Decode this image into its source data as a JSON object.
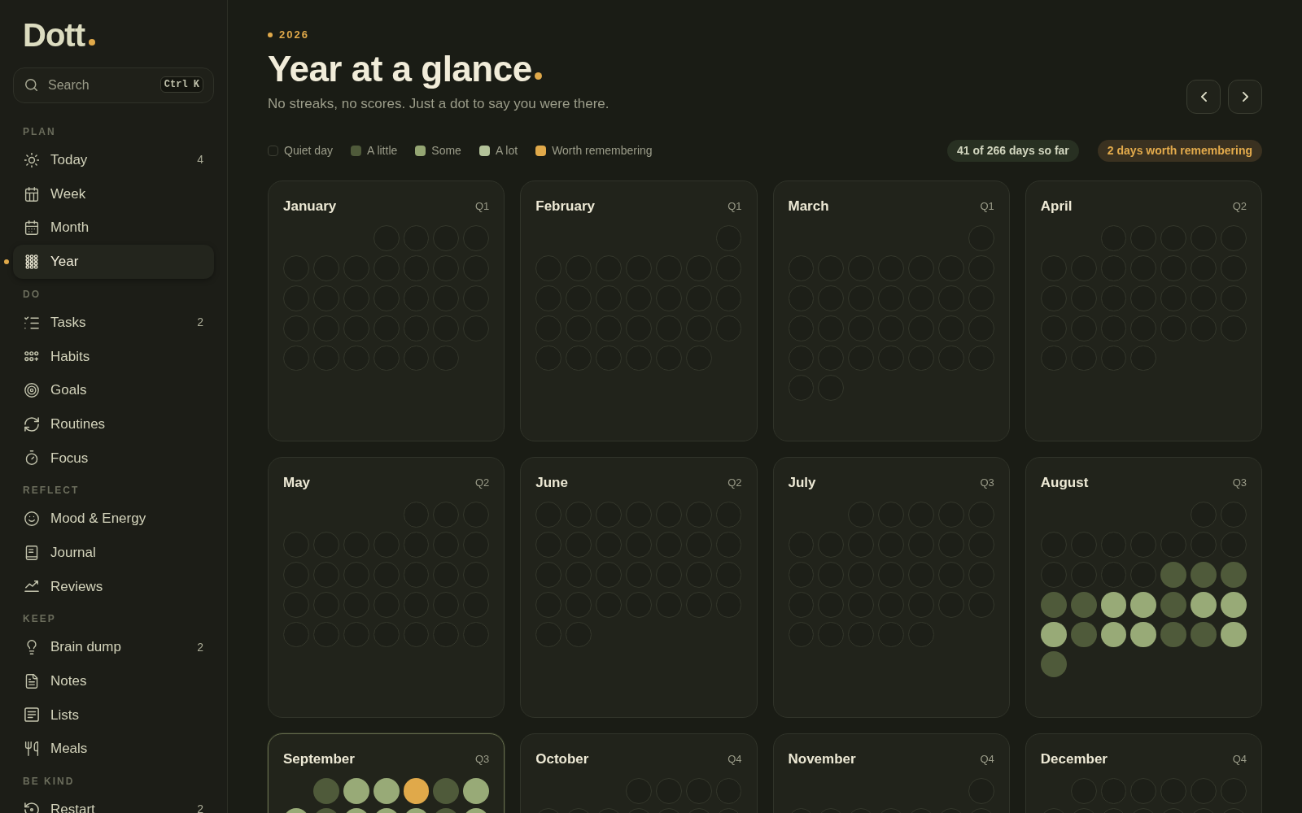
{
  "sidebar": {
    "logo": "Dott",
    "search": {
      "placeholder": "Search",
      "shortcut": "Ctrl K"
    },
    "sections": [
      {
        "label": "PLAN",
        "items": [
          {
            "label": "Today",
            "count": "4",
            "selected": false
          },
          {
            "label": "Week",
            "selected": false
          },
          {
            "label": "Month",
            "selected": false
          },
          {
            "label": "Year",
            "selected": true
          }
        ]
      },
      {
        "label": "DO",
        "items": [
          {
            "label": "Tasks",
            "count": "2",
            "selected": false
          },
          {
            "label": "Habits",
            "selected": false
          },
          {
            "label": "Goals",
            "selected": false
          },
          {
            "label": "Routines",
            "selected": false
          },
          {
            "label": "Focus",
            "selected": false
          }
        ]
      },
      {
        "label": "REFLECT",
        "items": [
          {
            "label": "Mood & Energy",
            "selected": false
          },
          {
            "label": "Journal",
            "selected": false
          },
          {
            "label": "Reviews",
            "selected": false
          }
        ]
      },
      {
        "label": "KEEP",
        "items": [
          {
            "label": "Brain dump",
            "count": "2",
            "selected": false
          },
          {
            "label": "Notes",
            "selected": false
          },
          {
            "label": "Lists",
            "selected": false
          },
          {
            "label": "Meals",
            "selected": false
          }
        ]
      },
      {
        "label": "BE KIND",
        "items": [
          {
            "label": "Restart",
            "count": "2",
            "selected": false
          }
        ]
      }
    ]
  },
  "header": {
    "eyebrow": "2026",
    "title": "Year at a glance",
    "subtitle": "No streaks, no scores. Just a dot to say you were there."
  },
  "legend": [
    {
      "kind": "quiet",
      "label": "Quiet day"
    },
    {
      "kind": "little",
      "label": "A little"
    },
    {
      "kind": "some",
      "label": "Some"
    },
    {
      "kind": "lot",
      "label": "A lot"
    },
    {
      "kind": "remember",
      "label": "Worth remembering"
    }
  ],
  "badges": [
    {
      "kind": "progress",
      "text": "41 of 266 days so far"
    },
    {
      "kind": "remember",
      "text": "2 days worth remembering"
    }
  ],
  "months": [
    {
      "name": "January",
      "quarter": "Q1",
      "current": false,
      "weeks": [
        [
          {
            "kind": "blank"
          },
          {
            "kind": "blank"
          },
          {
            "kind": "blank"
          },
          {
            "kind": "quiet"
          },
          {
            "kind": "quiet"
          },
          {
            "kind": "quiet"
          },
          {
            "kind": "quiet"
          }
        ],
        [
          {
            "kind": "quiet"
          },
          {
            "kind": "quiet"
          },
          {
            "kind": "quiet"
          },
          {
            "kind": "quiet"
          },
          {
            "kind": "quiet"
          },
          {
            "kind": "quiet"
          },
          {
            "kind": "quiet"
          }
        ],
        [
          {
            "kind": "quiet"
          },
          {
            "kind": "quiet"
          },
          {
            "kind": "quiet"
          },
          {
            "kind": "quiet"
          },
          {
            "kind": "quiet"
          },
          {
            "kind": "quiet"
          },
          {
            "kind": "quiet"
          }
        ],
        [
          {
            "kind": "quiet"
          },
          {
            "kind": "quiet"
          },
          {
            "kind": "quiet"
          },
          {
            "kind": "quiet"
          },
          {
            "kind": "quiet"
          },
          {
            "kind": "quiet"
          },
          {
            "kind": "quiet"
          }
        ],
        [
          {
            "kind": "quiet"
          },
          {
            "kind": "quiet"
          },
          {
            "kind": "quiet"
          },
          {
            "kind": "quiet"
          },
          {
            "kind": "quiet"
          },
          {
            "kind": "quiet"
          }
        ]
      ]
    },
    {
      "name": "February",
      "quarter": "Q1",
      "current": false,
      "weeks": [
        [
          {
            "kind": "blank"
          },
          {
            "kind": "blank"
          },
          {
            "kind": "blank"
          },
          {
            "kind": "blank"
          },
          {
            "kind": "blank"
          },
          {
            "kind": "blank"
          },
          {
            "kind": "quiet"
          }
        ],
        [
          {
            "kind": "quiet"
          },
          {
            "kind": "quiet"
          },
          {
            "kind": "quiet"
          },
          {
            "kind": "quiet"
          },
          {
            "kind": "quiet"
          },
          {
            "kind": "quiet"
          },
          {
            "kind": "quiet"
          }
        ],
        [
          {
            "kind": "quiet"
          },
          {
            "kind": "quiet"
          },
          {
            "kind": "quiet"
          },
          {
            "kind": "quiet"
          },
          {
            "kind": "quiet"
          },
          {
            "kind": "quiet"
          },
          {
            "kind": "quiet"
          }
        ],
        [
          {
            "kind": "quiet"
          },
          {
            "kind": "quiet"
          },
          {
            "kind": "quiet"
          },
          {
            "kind": "quiet"
          },
          {
            "kind": "quiet"
          },
          {
            "kind": "quiet"
          },
          {
            "kind": "quiet"
          }
        ],
        [
          {
            "kind": "quiet"
          },
          {
            "kind": "quiet"
          },
          {
            "kind": "quiet"
          },
          {
            "kind": "quiet"
          },
          {
            "kind": "quiet"
          },
          {
            "kind": "quiet"
          }
        ]
      ]
    },
    {
      "name": "March",
      "quarter": "Q1",
      "current": false,
      "weeks": [
        [
          {
            "kind": "blank"
          },
          {
            "kind": "blank"
          },
          {
            "kind": "blank"
          },
          {
            "kind": "blank"
          },
          {
            "kind": "blank"
          },
          {
            "kind": "blank"
          },
          {
            "kind": "quiet"
          }
        ],
        [
          {
            "kind": "quiet"
          },
          {
            "kind": "quiet"
          },
          {
            "kind": "quiet"
          },
          {
            "kind": "quiet"
          },
          {
            "kind": "quiet"
          },
          {
            "kind": "quiet"
          },
          {
            "kind": "quiet"
          }
        ],
        [
          {
            "kind": "quiet"
          },
          {
            "kind": "quiet"
          },
          {
            "kind": "quiet"
          },
          {
            "kind": "quiet"
          },
          {
            "kind": "quiet"
          },
          {
            "kind": "quiet"
          },
          {
            "kind": "quiet"
          }
        ],
        [
          {
            "kind": "quiet"
          },
          {
            "kind": "quiet"
          },
          {
            "kind": "quiet"
          },
          {
            "kind": "quiet"
          },
          {
            "kind": "quiet"
          },
          {
            "kind": "quiet"
          },
          {
            "kind": "quiet"
          }
        ],
        [
          {
            "kind": "quiet"
          },
          {
            "kind": "quiet"
          },
          {
            "kind": "quiet"
          },
          {
            "kind": "quiet"
          },
          {
            "kind": "quiet"
          },
          {
            "kind": "quiet"
          },
          {
            "kind": "quiet"
          }
        ],
        [
          {
            "kind": "quiet"
          },
          {
            "kind": "quiet"
          }
        ]
      ]
    },
    {
      "name": "April",
      "quarter": "Q2",
      "current": false,
      "weeks": [
        [
          {
            "kind": "blank"
          },
          {
            "kind": "blank"
          },
          {
            "kind": "quiet"
          },
          {
            "kind": "quiet"
          },
          {
            "kind": "quiet"
          },
          {
            "kind": "quiet"
          },
          {
            "kind": "quiet"
          }
        ],
        [
          {
            "kind": "quiet"
          },
          {
            "kind": "quiet"
          },
          {
            "kind": "quiet"
          },
          {
            "kind": "quiet"
          },
          {
            "kind": "quiet"
          },
          {
            "kind": "quiet"
          },
          {
            "kind": "quiet"
          }
        ],
        [
          {
            "kind": "quiet"
          },
          {
            "kind": "quiet"
          },
          {
            "kind": "quiet"
          },
          {
            "kind": "quiet"
          },
          {
            "kind": "quiet"
          },
          {
            "kind": "quiet"
          },
          {
            "kind": "quiet"
          }
        ],
        [
          {
            "kind": "quiet"
          },
          {
            "kind": "quiet"
          },
          {
            "kind": "quiet"
          },
          {
            "kind": "quiet"
          },
          {
            "kind": "quiet"
          },
          {
            "kind": "quiet"
          },
          {
            "kind": "quiet"
          }
        ],
        [
          {
            "kind": "quiet"
          },
          {
            "kind": "quiet"
          },
          {
            "kind": "quiet"
          },
          {
            "kind": "quiet"
          }
        ]
      ]
    },
    {
      "name": "May",
      "quarter": "Q2",
      "current": false,
      "weeks": [
        [
          {
            "kind": "blank"
          },
          {
            "kind": "blank"
          },
          {
            "kind": "blank"
          },
          {
            "kind": "blank"
          },
          {
            "kind": "quiet"
          },
          {
            "kind": "quiet"
          },
          {
            "kind": "quiet"
          }
        ],
        [
          {
            "kind": "quiet"
          },
          {
            "kind": "quiet"
          },
          {
            "kind": "quiet"
          },
          {
            "kind": "quiet"
          },
          {
            "kind": "quiet"
          },
          {
            "kind": "quiet"
          },
          {
            "kind": "quiet"
          }
        ],
        [
          {
            "kind": "quiet"
          },
          {
            "kind": "quiet"
          },
          {
            "kind": "quiet"
          },
          {
            "kind": "quiet"
          },
          {
            "kind": "quiet"
          },
          {
            "kind": "quiet"
          },
          {
            "kind": "quiet"
          }
        ],
        [
          {
            "kind": "quiet"
          },
          {
            "kind": "quiet"
          },
          {
            "kind": "quiet"
          },
          {
            "kind": "quiet"
          },
          {
            "kind": "quiet"
          },
          {
            "kind": "quiet"
          },
          {
            "kind": "quiet"
          }
        ],
        [
          {
            "kind": "quiet"
          },
          {
            "kind": "quiet"
          },
          {
            "kind": "quiet"
          },
          {
            "kind": "quiet"
          },
          {
            "kind": "quiet"
          },
          {
            "kind": "quiet"
          },
          {
            "kind": "quiet"
          }
        ]
      ]
    },
    {
      "name": "June",
      "quarter": "Q2",
      "current": false,
      "weeks": [
        [
          {
            "kind": "quiet"
          },
          {
            "kind": "quiet"
          },
          {
            "kind": "quiet"
          },
          {
            "kind": "quiet"
          },
          {
            "kind": "quiet"
          },
          {
            "kind": "quiet"
          },
          {
            "kind": "quiet"
          }
        ],
        [
          {
            "kind": "quiet"
          },
          {
            "kind": "quiet"
          },
          {
            "kind": "quiet"
          },
          {
            "kind": "quiet"
          },
          {
            "kind": "quiet"
          },
          {
            "kind": "quiet"
          },
          {
            "kind": "quiet"
          }
        ],
        [
          {
            "kind": "quiet"
          },
          {
            "kind": "quiet"
          },
          {
            "kind": "quiet"
          },
          {
            "kind": "quiet"
          },
          {
            "kind": "quiet"
          },
          {
            "kind": "quiet"
          },
          {
            "kind": "quiet"
          }
        ],
        [
          {
            "kind": "quiet"
          },
          {
            "kind": "quiet"
          },
          {
            "kind": "quiet"
          },
          {
            "kind": "quiet"
          },
          {
            "kind": "quiet"
          },
          {
            "kind": "quiet"
          },
          {
            "kind": "quiet"
          }
        ],
        [
          {
            "kind": "quiet"
          },
          {
            "kind": "quiet"
          }
        ]
      ]
    },
    {
      "name": "July",
      "quarter": "Q3",
      "current": false,
      "weeks": [
        [
          {
            "kind": "blank"
          },
          {
            "kind": "blank"
          },
          {
            "kind": "quiet"
          },
          {
            "kind": "quiet"
          },
          {
            "kind": "quiet"
          },
          {
            "kind": "quiet"
          },
          {
            "kind": "quiet"
          }
        ],
        [
          {
            "kind": "quiet"
          },
          {
            "kind": "quiet"
          },
          {
            "kind": "quiet"
          },
          {
            "kind": "quiet"
          },
          {
            "kind": "quiet"
          },
          {
            "kind": "quiet"
          },
          {
            "kind": "quiet"
          }
        ],
        [
          {
            "kind": "quiet"
          },
          {
            "kind": "quiet"
          },
          {
            "kind": "quiet"
          },
          {
            "kind": "quiet"
          },
          {
            "kind": "quiet"
          },
          {
            "kind": "quiet"
          },
          {
            "kind": "quiet"
          }
        ],
        [
          {
            "kind": "quiet"
          },
          {
            "kind": "quiet"
          },
          {
            "kind": "quiet"
          },
          {
            "kind": "quiet"
          },
          {
            "kind": "quiet"
          },
          {
            "kind": "quiet"
          },
          {
            "kind": "quiet"
          }
        ],
        [
          {
            "kind": "quiet"
          },
          {
            "kind": "quiet"
          },
          {
            "kind": "quiet"
          },
          {
            "kind": "quiet"
          },
          {
            "kind": "quiet"
          }
        ]
      ]
    },
    {
      "name": "August",
      "quarter": "Q3",
      "current": false,
      "weeks": [
        [
          {
            "kind": "blank"
          },
          {
            "kind": "blank"
          },
          {
            "kind": "blank"
          },
          {
            "kind": "blank"
          },
          {
            "kind": "blank"
          },
          {
            "kind": "quiet"
          },
          {
            "kind": "quiet"
          }
        ],
        [
          {
            "kind": "quiet"
          },
          {
            "kind": "quiet"
          },
          {
            "kind": "quiet"
          },
          {
            "kind": "quiet"
          },
          {
            "kind": "quiet"
          },
          {
            "kind": "quiet"
          },
          {
            "kind": "quiet"
          }
        ],
        [
          {
            "kind": "quiet"
          },
          {
            "kind": "quiet"
          },
          {
            "kind": "quiet"
          },
          {
            "kind": "quiet"
          },
          {
            "kind": "little"
          },
          {
            "kind": "little"
          },
          {
            "kind": "little"
          }
        ],
        [
          {
            "kind": "little"
          },
          {
            "kind": "little"
          },
          {
            "kind": "some"
          },
          {
            "kind": "some"
          },
          {
            "kind": "little"
          },
          {
            "kind": "some"
          },
          {
            "kind": "some"
          }
        ],
        [
          {
            "kind": "some"
          },
          {
            "kind": "little"
          },
          {
            "kind": "some"
          },
          {
            "kind": "some"
          },
          {
            "kind": "little"
          },
          {
            "kind": "little"
          },
          {
            "kind": "some"
          }
        ],
        [
          {
            "kind": "little"
          }
        ]
      ]
    },
    {
      "name": "September",
      "quarter": "Q3",
      "current": true,
      "weeks": [
        [
          {
            "kind": "blank"
          },
          {
            "kind": "little"
          },
          {
            "kind": "some"
          },
          {
            "kind": "some"
          },
          {
            "kind": "remember"
          },
          {
            "kind": "little"
          },
          {
            "kind": "some"
          }
        ],
        [
          {
            "kind": "some"
          },
          {
            "kind": "little"
          },
          {
            "kind": "some"
          },
          {
            "kind": "some"
          },
          {
            "kind": "some"
          },
          {
            "kind": "little"
          },
          {
            "kind": "some"
          }
        ]
      ]
    },
    {
      "name": "October",
      "quarter": "Q4",
      "current": false,
      "weeks": [
        [
          {
            "kind": "blank"
          },
          {
            "kind": "blank"
          },
          {
            "kind": "blank"
          },
          {
            "kind": "quiet"
          },
          {
            "kind": "quiet"
          },
          {
            "kind": "quiet"
          },
          {
            "kind": "quiet"
          }
        ],
        [
          {
            "kind": "quiet"
          },
          {
            "kind": "quiet"
          },
          {
            "kind": "quiet"
          },
          {
            "kind": "quiet"
          },
          {
            "kind": "quiet"
          },
          {
            "kind": "quiet"
          },
          {
            "kind": "quiet"
          }
        ]
      ]
    },
    {
      "name": "November",
      "quarter": "Q4",
      "current": false,
      "weeks": [
        [
          {
            "kind": "blank"
          },
          {
            "kind": "blank"
          },
          {
            "kind": "blank"
          },
          {
            "kind": "blank"
          },
          {
            "kind": "blank"
          },
          {
            "kind": "blank"
          },
          {
            "kind": "quiet"
          }
        ],
        [
          {
            "kind": "quiet"
          },
          {
            "kind": "quiet"
          },
          {
            "kind": "quiet"
          },
          {
            "kind": "quiet"
          },
          {
            "kind": "quiet"
          },
          {
            "kind": "quiet"
          },
          {
            "kind": "quiet"
          }
        ]
      ]
    },
    {
      "name": "December",
      "quarter": "Q4",
      "current": false,
      "weeks": [
        [
          {
            "kind": "blank"
          },
          {
            "kind": "quiet"
          },
          {
            "kind": "quiet"
          },
          {
            "kind": "quiet"
          },
          {
            "kind": "quiet"
          },
          {
            "kind": "quiet"
          },
          {
            "kind": "quiet"
          }
        ],
        [
          {
            "kind": "quiet"
          },
          {
            "kind": "quiet"
          },
          {
            "kind": "quiet"
          },
          {
            "kind": "quiet"
          },
          {
            "kind": "quiet"
          },
          {
            "kind": "quiet"
          },
          {
            "kind": "quiet"
          }
        ]
      ]
    }
  ]
}
